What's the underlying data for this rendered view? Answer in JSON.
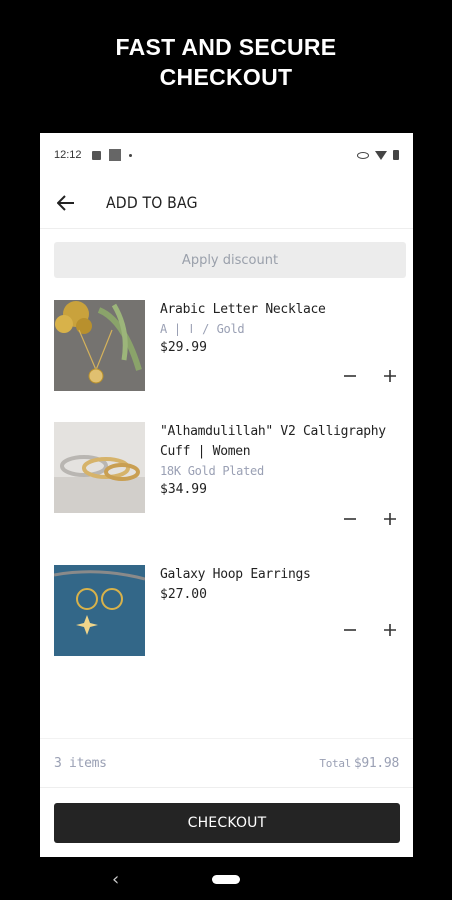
{
  "headline": {
    "line1": "FAST AND SECURE",
    "line2": "CHECKOUT"
  },
  "status_bar": {
    "time": "12:12"
  },
  "header": {
    "title": "ADD TO BAG",
    "back_icon": "arrow-left-icon"
  },
  "discount": {
    "label": "Apply discount"
  },
  "cart": {
    "items": [
      {
        "name": "Arabic Letter Necklace",
        "variant": "A | ا / Gold",
        "price": "$29.99"
      },
      {
        "name": "\"Alhamdulillah\" V2 Calligraphy Cuff | Women",
        "variant": "18K Gold Plated",
        "price": "$34.99"
      },
      {
        "name": "Galaxy Hoop Earrings",
        "variant": "",
        "price": "$27.00"
      }
    ]
  },
  "summary": {
    "items_count": "3 items",
    "total_label": "Total",
    "total_value": "$91.98"
  },
  "checkout": {
    "label": "CHECKOUT"
  },
  "colors": {
    "background": "#000000",
    "button_dark": "#242424",
    "muted_text": "#9aa0b4"
  }
}
